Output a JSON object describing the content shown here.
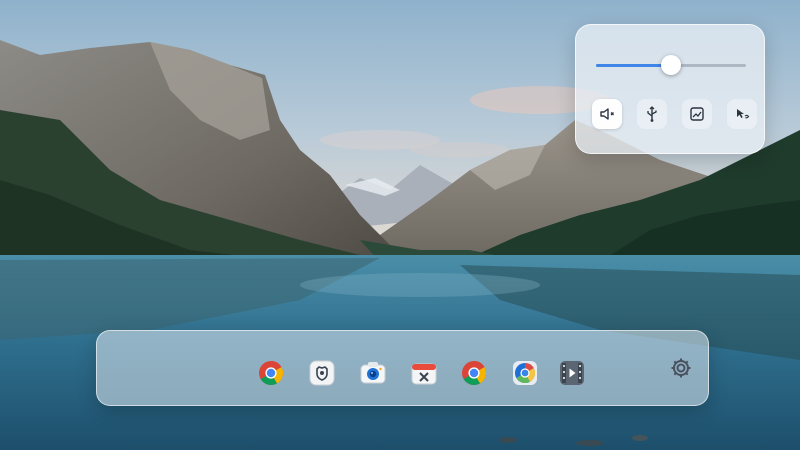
{
  "wallpaper": {
    "subject": "mountain-lake-landscape"
  },
  "quick_settings": {
    "volume_level_percent": 50,
    "accent_color": "#3f86e8",
    "buttons": [
      {
        "icon": "speaker-volume-icon",
        "active": true
      },
      {
        "icon": "usb-icon",
        "active": false
      },
      {
        "icon": "chart-window-icon",
        "active": false
      },
      {
        "icon": "mouse-cursor-icon",
        "active": false
      }
    ]
  },
  "dock": {
    "apps": [
      {
        "icon": "chrome-icon"
      },
      {
        "icon": "shield-cat-icon"
      },
      {
        "icon": "camera-icon"
      },
      {
        "icon": "close-box-icon"
      },
      {
        "icon": "chrome-icon"
      },
      {
        "icon": "chromium-icon"
      },
      {
        "icon": "film-player-icon"
      }
    ],
    "settings_icon": "gear-icon"
  }
}
